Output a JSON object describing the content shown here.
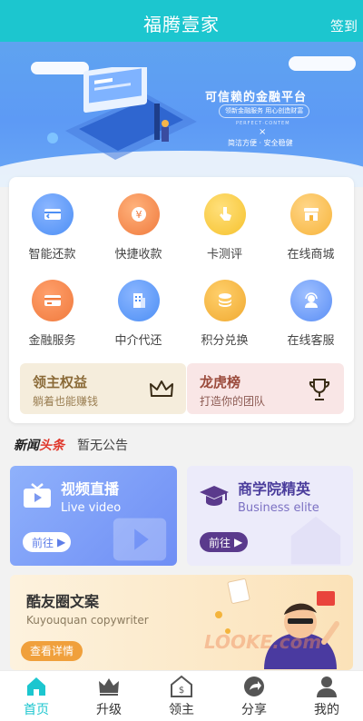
{
  "header": {
    "title": "福腾壹家",
    "signin": "签到"
  },
  "banner": {
    "slogan": "可信赖的金融平台",
    "tag": "领新金融服务 用心创造财富",
    "sub": "PERFECT·CONTEM",
    "cross": "×",
    "sub2": "简洁方便 · 安全稳健"
  },
  "services": [
    {
      "label": "智能还款",
      "icon": "card-repay-icon",
      "color": "#4d8ff5"
    },
    {
      "label": "快捷收款",
      "icon": "yen-coin-icon",
      "color": "#f07a3d"
    },
    {
      "label": "卡测评",
      "icon": "tap-icon",
      "color": "#f6c22d"
    },
    {
      "label": "在线商城",
      "icon": "store-icon",
      "color": "#f7b43a"
    },
    {
      "label": "金融服务",
      "icon": "credit-card-icon",
      "color": "#f07a3d"
    },
    {
      "label": "中介代还",
      "icon": "building-icon",
      "color": "#4d8ff5"
    },
    {
      "label": "积分兑换",
      "icon": "coins-stack-icon",
      "color": "#f0a930"
    },
    {
      "label": "在线客服",
      "icon": "customer-service-icon",
      "color": "#5a8ef5"
    }
  ],
  "promos": {
    "left": {
      "title": "领主权益",
      "subtitle": "躺着也能赚钱",
      "icon": "crown-icon"
    },
    "right": {
      "title": "龙虎榜",
      "subtitle": "打造你的团队",
      "icon": "trophy-icon"
    }
  },
  "news": {
    "brand_a": "新闻",
    "brand_b": "头条",
    "message": "暂无公告"
  },
  "features": {
    "video": {
      "title": "视频直播",
      "subtitle": "Live video",
      "button": "前往"
    },
    "biz": {
      "title": "商学院精英",
      "subtitle": "Business elite",
      "button": "前往"
    }
  },
  "copywriting": {
    "title": "酷友圈文案",
    "subtitle": "Kuyouquan copywriter",
    "button": "查看详情",
    "watermark": "LOOKE.com"
  },
  "tabs": [
    {
      "label": "首页",
      "icon": "home-icon",
      "active": true
    },
    {
      "label": "升级",
      "icon": "crown-icon",
      "active": false
    },
    {
      "label": "领主",
      "icon": "house-dollar-icon",
      "active": false
    },
    {
      "label": "分享",
      "icon": "share-icon",
      "active": false
    },
    {
      "label": "我的",
      "icon": "user-icon",
      "active": false
    }
  ],
  "colors": {
    "accent": "#1cc6cf",
    "banner": "#5d9af5"
  }
}
